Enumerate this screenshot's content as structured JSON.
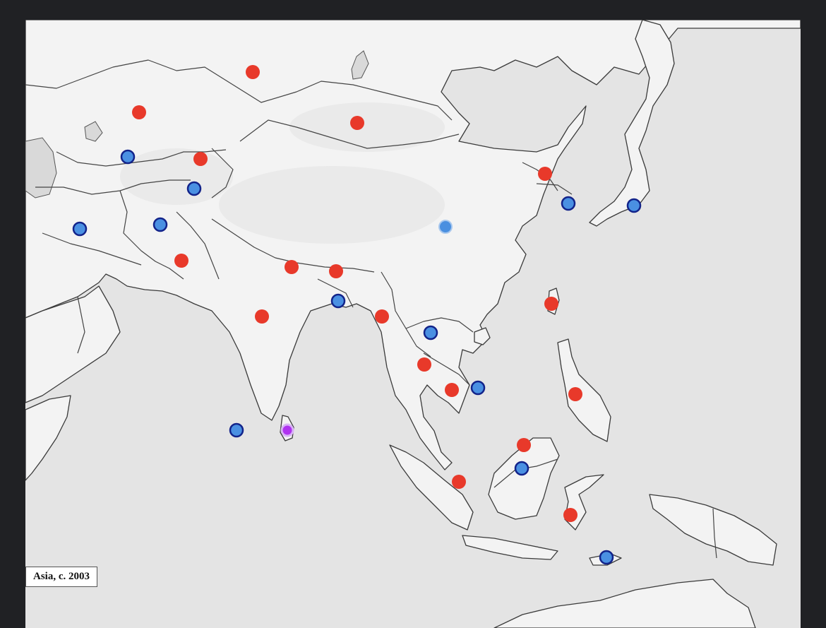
{
  "caption": "Asia, c. 2003",
  "colors": {
    "red": "#e8392a",
    "blue_fill": "#4a90e2",
    "blue_stroke": "#12238a",
    "light_blue": "#4a8fe0",
    "purple": "#b033f0",
    "background": "#202124",
    "sea": "#e4e4e4",
    "land": "#f3f3f3"
  },
  "markers": [
    {
      "style": "red"
    },
    {
      "style": "red"
    },
    {
      "style": "red"
    },
    {
      "style": "blue"
    },
    {
      "style": "red"
    },
    {
      "style": "blue"
    },
    {
      "style": "red"
    },
    {
      "style": "blue"
    },
    {
      "style": "blue"
    },
    {
      "style": "blue"
    },
    {
      "style": "blue"
    },
    {
      "style": "light-blue"
    },
    {
      "style": "red"
    },
    {
      "style": "red"
    },
    {
      "style": "red"
    },
    {
      "style": "blue"
    },
    {
      "style": "red"
    },
    {
      "style": "red"
    },
    {
      "style": "red"
    },
    {
      "style": "blue"
    },
    {
      "style": "red"
    },
    {
      "style": "red"
    },
    {
      "style": "blue"
    },
    {
      "style": "red"
    },
    {
      "style": "blue"
    },
    {
      "style": "purple"
    },
    {
      "style": "red"
    },
    {
      "style": "blue"
    },
    {
      "style": "red"
    },
    {
      "style": "red"
    },
    {
      "style": "blue"
    }
  ]
}
